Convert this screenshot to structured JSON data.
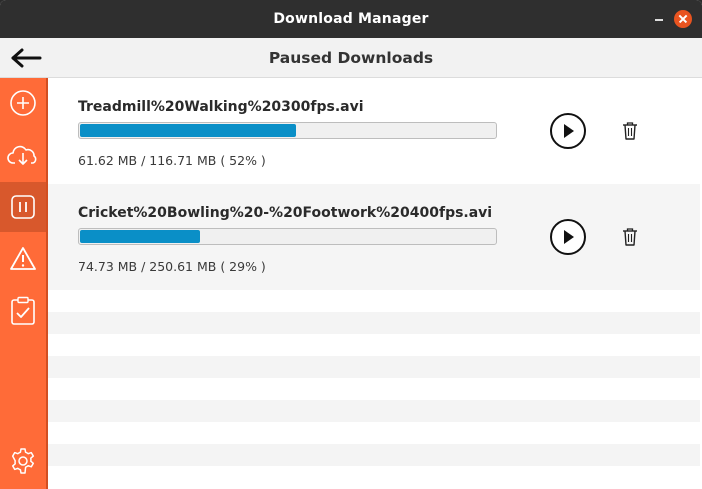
{
  "window": {
    "title": "Download Manager"
  },
  "header": {
    "title": "Paused Downloads"
  },
  "sidebar": {
    "items": [
      {
        "name": "add",
        "icon": "plus-circle-icon"
      },
      {
        "name": "downloading",
        "icon": "cloud-download-icon"
      },
      {
        "name": "paused",
        "icon": "pause-icon",
        "active": true
      },
      {
        "name": "failed",
        "icon": "warning-icon"
      },
      {
        "name": "completed",
        "icon": "clipboard-check-icon"
      },
      {
        "name": "settings",
        "icon": "gear-icon"
      }
    ],
    "color": "#ff6b38",
    "active_color": "#d8582c"
  },
  "downloads": [
    {
      "name": "Treadmill%20Walking%20300fps.avi",
      "size_text": "61.62 MB / 116.71 MB ( 52% )",
      "progress": 0.52
    },
    {
      "name": "Cricket%20Bowling%20-%20Footwork%20400fps.avi",
      "size_text": "74.73 MB / 250.61 MB ( 29% )",
      "progress": 0.29
    }
  ],
  "colors": {
    "progress_fill": "#0a8fc7",
    "close_button": "#e95420"
  }
}
